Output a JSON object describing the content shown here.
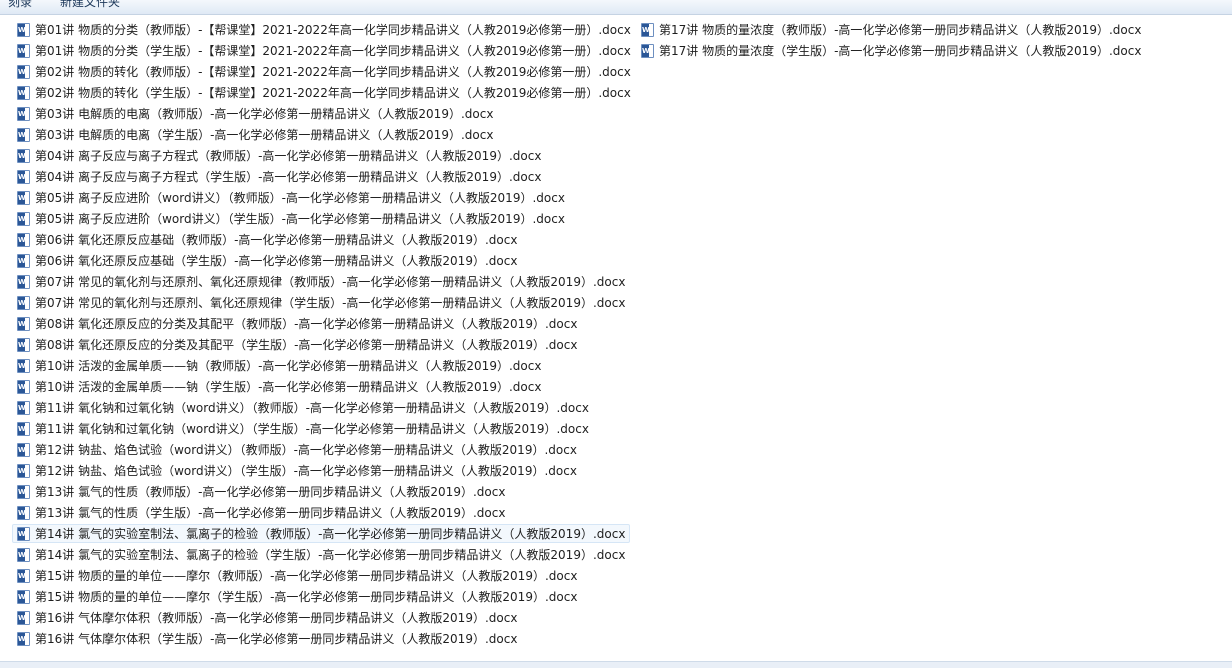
{
  "toolbar": {
    "left_label": "刻录",
    "new_folder_label": "新建文件夹"
  },
  "files_col1": [
    "第01讲 物质的分类（教师版）-【帮课堂】2021-2022年高一化学同步精品讲义（人教2019必修第一册）.docx",
    "第01讲 物质的分类（学生版）-【帮课堂】2021-2022年高一化学同步精品讲义（人教2019必修第一册）.docx",
    "第02讲 物质的转化（教师版）-【帮课堂】2021-2022年高一化学同步精品讲义（人教2019必修第一册）.docx",
    "第02讲 物质的转化（学生版）-【帮课堂】2021-2022年高一化学同步精品讲义（人教2019必修第一册）.docx",
    "第03讲 电解质的电离（教师版）-高一化学必修第一册精品讲义（人教版2019）.docx",
    "第03讲 电解质的电离（学生版）-高一化学必修第一册精品讲义（人教版2019）.docx",
    "第04讲 离子反应与离子方程式（教师版）-高一化学必修第一册精品讲义（人教版2019）.docx",
    "第04讲 离子反应与离子方程式（学生版）-高一化学必修第一册精品讲义（人教版2019）.docx",
    "第05讲 离子反应进阶（word讲义）（教师版）-高一化学必修第一册精品讲义（人教版2019）.docx",
    "第05讲 离子反应进阶（word讲义）（学生版）-高一化学必修第一册精品讲义（人教版2019）.docx",
    "第06讲 氧化还原反应基础（教师版）-高一化学必修第一册精品讲义（人教版2019）.docx",
    "第06讲 氧化还原反应基础（学生版）-高一化学必修第一册精品讲义（人教版2019）.docx",
    "第07讲 常见的氧化剂与还原剂、氧化还原规律（教师版）-高一化学必修第一册精品讲义（人教版2019）.docx",
    "第07讲 常见的氧化剂与还原剂、氧化还原规律（学生版）-高一化学必修第一册精品讲义（人教版2019）.docx",
    "第08讲 氧化还原反应的分类及其配平（教师版）-高一化学必修第一册精品讲义（人教版2019）.docx",
    "第08讲 氧化还原反应的分类及其配平（学生版）-高一化学必修第一册精品讲义（人教版2019）.docx",
    "第10讲 活泼的金属单质——钠（教师版）-高一化学必修第一册精品讲义（人教版2019）.docx",
    "第10讲 活泼的金属单质——钠（学生版）-高一化学必修第一册精品讲义（人教版2019）.docx",
    "第11讲 氧化钠和过氧化钠（word讲义）（教师版）-高一化学必修第一册精品讲义（人教版2019）.docx",
    "第11讲 氧化钠和过氧化钠（word讲义）（学生版）-高一化学必修第一册精品讲义（人教版2019）.docx",
    "第12讲 钠盐、焰色试验（word讲义）（教师版）-高一化学必修第一册精品讲义（人教版2019）.docx",
    "第12讲 钠盐、焰色试验（word讲义）（学生版）-高一化学必修第一册精品讲义（人教版2019）.docx",
    "第13讲 氯气的性质（教师版）-高一化学必修第一册同步精品讲义（人教版2019）.docx",
    "第13讲 氯气的性质（学生版）-高一化学必修第一册同步精品讲义（人教版2019）.docx",
    "第14讲 氯气的实验室制法、氯离子的检验（教师版）-高一化学必修第一册同步精品讲义（人教版2019）.docx",
    "第14讲 氯气的实验室制法、氯离子的检验（学生版）-高一化学必修第一册同步精品讲义（人教版2019）.docx",
    "第15讲 物质的量的单位——摩尔（教师版）-高一化学必修第一册同步精品讲义（人教版2019）.docx",
    "第15讲 物质的量的单位——摩尔（学生版）-高一化学必修第一册同步精品讲义（人教版2019）.docx",
    "第16讲 气体摩尔体积（教师版）-高一化学必修第一册同步精品讲义（人教版2019）.docx",
    "第16讲 气体摩尔体积（学生版）-高一化学必修第一册同步精品讲义（人教版2019）.docx"
  ],
  "files_col2": [
    "第17讲 物质的量浓度（教师版）-高一化学必修第一册同步精品讲义（人教版2019）.docx",
    "第17讲 物质的量浓度（学生版）-高一化学必修第一册同步精品讲义（人教版2019）.docx"
  ],
  "hovered_index_col1": 24,
  "icon": "word-doc-icon"
}
